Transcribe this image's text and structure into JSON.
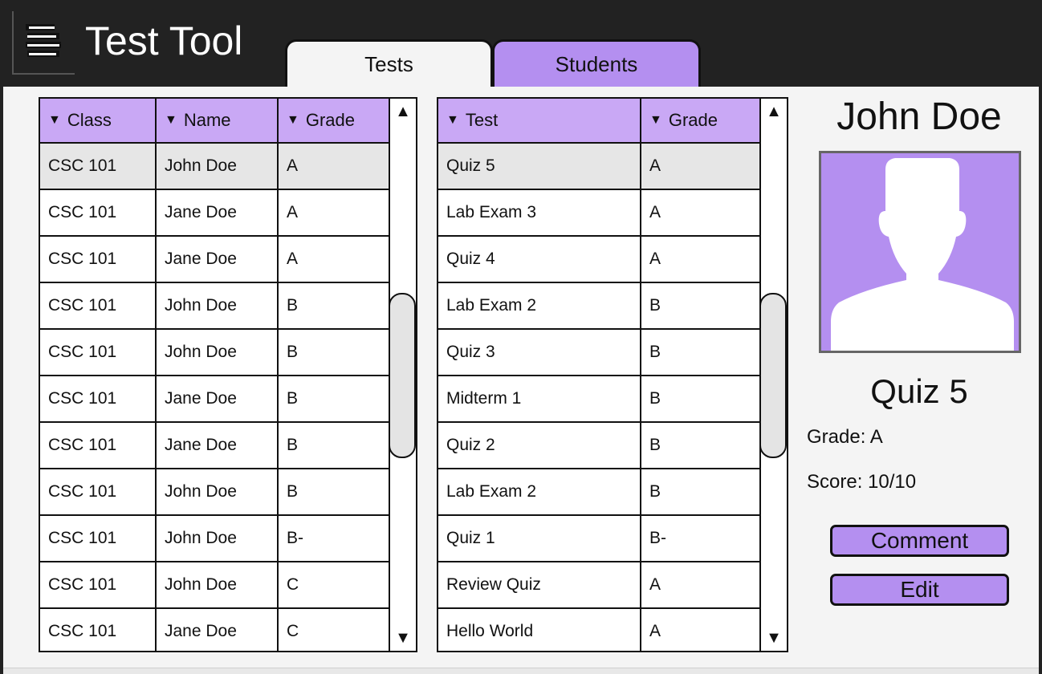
{
  "app": {
    "title": "Test Tool",
    "icon": "menu-lines-icon"
  },
  "tabs": [
    {
      "label": "Tests",
      "active": false
    },
    {
      "label": "Students",
      "active": true
    }
  ],
  "students_table": {
    "headers": [
      "Class",
      "Name",
      "Grade"
    ],
    "rows": [
      [
        "CSC 101",
        "John Doe",
        "A"
      ],
      [
        "CSC 101",
        "Jane Doe",
        "A"
      ],
      [
        "CSC 101",
        "Jane Doe",
        "A"
      ],
      [
        "CSC 101",
        "John Doe",
        "B"
      ],
      [
        "CSC 101",
        "John Doe",
        "B"
      ],
      [
        "CSC 101",
        "Jane Doe",
        "B"
      ],
      [
        "CSC 101",
        "Jane Doe",
        "B"
      ],
      [
        "CSC 101",
        "John Doe",
        "B"
      ],
      [
        "CSC 101",
        "John Doe",
        "B-"
      ],
      [
        "CSC 101",
        "John Doe",
        "C"
      ],
      [
        "CSC 101",
        "Jane Doe",
        "C"
      ]
    ],
    "selected_row": 0
  },
  "tests_table": {
    "headers": [
      "Test",
      "Grade"
    ],
    "rows": [
      [
        "Quiz 5",
        "A"
      ],
      [
        "Lab Exam 3",
        "A"
      ],
      [
        "Quiz 4",
        "A"
      ],
      [
        "Lab Exam 2",
        "B"
      ],
      [
        "Quiz 3",
        "B"
      ],
      [
        "Midterm 1",
        "B"
      ],
      [
        "Quiz 2",
        "B"
      ],
      [
        "Lab Exam 2",
        "B"
      ],
      [
        "Quiz 1",
        "B-"
      ],
      [
        "Review Quiz",
        "A"
      ],
      [
        "Hello World",
        "A"
      ]
    ],
    "selected_row": 0
  },
  "detail": {
    "student_name": "John Doe",
    "avatar_icon": "person-silhouette-icon",
    "test_name": "Quiz 5",
    "grade_text": "Grade: A",
    "score_text": "Score: 10/10",
    "comment_label": "Comment",
    "edit_label": "Edit"
  },
  "colors": {
    "accent": "#b48ff0",
    "header_cell": "#c9a8f5",
    "header_bar": "#222222",
    "selected_row": "#e6e6e6"
  }
}
